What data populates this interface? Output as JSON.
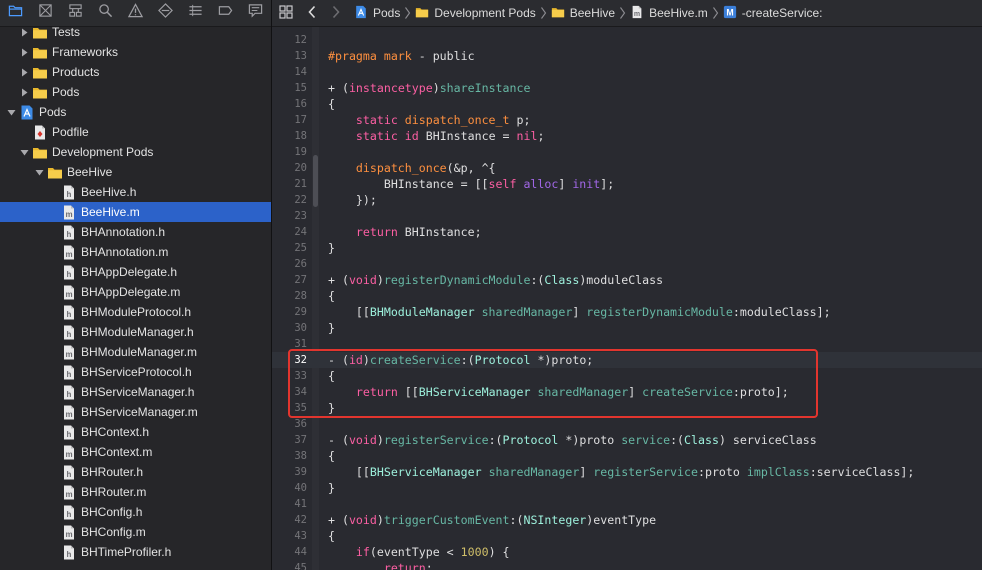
{
  "navigator": {
    "toolbar_icons": [
      "folder-icon",
      "source-control-icon",
      "hierarchy-icon",
      "search-icon",
      "warning-icon",
      "test-icon",
      "debug-icon",
      "breakpoint-icon",
      "report-icon"
    ],
    "tree": [
      {
        "label": "Tests",
        "kind": "folder",
        "depth": 1,
        "expanded": false
      },
      {
        "label": "Frameworks",
        "kind": "folder",
        "depth": 1,
        "expanded": false
      },
      {
        "label": "Products",
        "kind": "folder",
        "depth": 1,
        "expanded": false
      },
      {
        "label": "Pods",
        "kind": "folder",
        "depth": 1,
        "expanded": false
      },
      {
        "label": "Pods",
        "kind": "project",
        "depth": 0,
        "expanded": true
      },
      {
        "label": "Podfile",
        "kind": "ruby",
        "depth": 1,
        "expanded": null
      },
      {
        "label": "Development Pods",
        "kind": "folder",
        "depth": 1,
        "expanded": true
      },
      {
        "label": "BeeHive",
        "kind": "folder",
        "depth": 2,
        "expanded": true
      },
      {
        "label": "BeeHive.h",
        "kind": "h",
        "depth": 3,
        "expanded": null
      },
      {
        "label": "BeeHive.m",
        "kind": "m",
        "depth": 3,
        "expanded": null,
        "selected": true
      },
      {
        "label": "BHAnnotation.h",
        "kind": "h",
        "depth": 3,
        "expanded": null
      },
      {
        "label": "BHAnnotation.m",
        "kind": "m",
        "depth": 3,
        "expanded": null
      },
      {
        "label": "BHAppDelegate.h",
        "kind": "h",
        "depth": 3,
        "expanded": null
      },
      {
        "label": "BHAppDelegate.m",
        "kind": "m",
        "depth": 3,
        "expanded": null
      },
      {
        "label": "BHModuleProtocol.h",
        "kind": "h",
        "depth": 3,
        "expanded": null
      },
      {
        "label": "BHModuleManager.h",
        "kind": "h",
        "depth": 3,
        "expanded": null
      },
      {
        "label": "BHModuleManager.m",
        "kind": "m",
        "depth": 3,
        "expanded": null
      },
      {
        "label": "BHServiceProtocol.h",
        "kind": "h",
        "depth": 3,
        "expanded": null
      },
      {
        "label": "BHServiceManager.h",
        "kind": "h",
        "depth": 3,
        "expanded": null
      },
      {
        "label": "BHServiceManager.m",
        "kind": "m",
        "depth": 3,
        "expanded": null
      },
      {
        "label": "BHContext.h",
        "kind": "h",
        "depth": 3,
        "expanded": null
      },
      {
        "label": "BHContext.m",
        "kind": "m",
        "depth": 3,
        "expanded": null
      },
      {
        "label": "BHRouter.h",
        "kind": "h",
        "depth": 3,
        "expanded": null
      },
      {
        "label": "BHRouter.m",
        "kind": "m",
        "depth": 3,
        "expanded": null
      },
      {
        "label": "BHConfig.h",
        "kind": "h",
        "depth": 3,
        "expanded": null
      },
      {
        "label": "BHConfig.m",
        "kind": "m",
        "depth": 3,
        "expanded": null
      },
      {
        "label": "BHTimeProfiler.h",
        "kind": "h",
        "depth": 3,
        "expanded": null
      }
    ]
  },
  "jumpbar": {
    "crumbs": [
      {
        "label": "Pods",
        "icon": "project-icon"
      },
      {
        "label": "Development Pods",
        "icon": "folder-icon"
      },
      {
        "label": "BeeHive",
        "icon": "folder-icon"
      },
      {
        "label": "BeeHive.m",
        "icon": "m-file-icon"
      },
      {
        "label": "-createService:",
        "icon": "method-icon"
      }
    ]
  },
  "editor": {
    "current_line": 32,
    "lines": [
      {
        "n": "12",
        "tokens": [
          [
            "pln",
            ""
          ]
        ]
      },
      {
        "n": "13",
        "tokens": [
          [
            "pre",
            "#pragma mark"
          ],
          [
            "pln",
            " - public"
          ]
        ]
      },
      {
        "n": "14",
        "tokens": [
          [
            "pln",
            ""
          ]
        ]
      },
      {
        "n": "15",
        "tokens": [
          [
            "pln",
            "+ ("
          ],
          [
            "kw",
            "instancetype"
          ],
          [
            "pln",
            ")"
          ],
          [
            "meth",
            "shareInstance"
          ]
        ]
      },
      {
        "n": "16",
        "tokens": [
          [
            "pln",
            "{"
          ]
        ]
      },
      {
        "n": "17",
        "tokens": [
          [
            "pln",
            "    "
          ],
          [
            "kw",
            "static"
          ],
          [
            "pln",
            " "
          ],
          [
            "org",
            "dispatch_once_t"
          ],
          [
            "pln",
            " p;"
          ]
        ]
      },
      {
        "n": "18",
        "tokens": [
          [
            "pln",
            "    "
          ],
          [
            "kw",
            "static"
          ],
          [
            "pln",
            " "
          ],
          [
            "kw",
            "id"
          ],
          [
            "pln",
            " BHInstance = "
          ],
          [
            "kw",
            "nil"
          ],
          [
            "pln",
            ";"
          ]
        ]
      },
      {
        "n": "19",
        "tokens": [
          [
            "pln",
            ""
          ]
        ]
      },
      {
        "n": "20",
        "tokens": [
          [
            "pln",
            "    "
          ],
          [
            "org",
            "dispatch_once"
          ],
          [
            "pln",
            "(&p, ^{"
          ]
        ]
      },
      {
        "n": "21",
        "tokens": [
          [
            "pln",
            "        BHInstance = [["
          ],
          [
            "kw",
            "self"
          ],
          [
            "pln",
            " "
          ],
          [
            "sys",
            "alloc"
          ],
          [
            "pln",
            "] "
          ],
          [
            "sys",
            "init"
          ],
          [
            "pln",
            "];"
          ]
        ]
      },
      {
        "n": "22",
        "tokens": [
          [
            "pln",
            "    });"
          ]
        ]
      },
      {
        "n": "23",
        "tokens": [
          [
            "pln",
            ""
          ]
        ]
      },
      {
        "n": "24",
        "tokens": [
          [
            "pln",
            "    "
          ],
          [
            "kw",
            "return"
          ],
          [
            "pln",
            " BHInstance;"
          ]
        ]
      },
      {
        "n": "25",
        "tokens": [
          [
            "pln",
            "}"
          ]
        ]
      },
      {
        "n": "26",
        "tokens": [
          [
            "pln",
            ""
          ]
        ]
      },
      {
        "n": "27",
        "tokens": [
          [
            "pln",
            "+ ("
          ],
          [
            "kw",
            "void"
          ],
          [
            "pln",
            ")"
          ],
          [
            "meth",
            "registerDynamicModule"
          ],
          [
            "pln",
            ":("
          ],
          [
            "usr",
            "Class"
          ],
          [
            "pln",
            ")moduleClass"
          ]
        ]
      },
      {
        "n": "28",
        "tokens": [
          [
            "pln",
            "{"
          ]
        ]
      },
      {
        "n": "29",
        "tokens": [
          [
            "pln",
            "    [["
          ],
          [
            "usr",
            "BHModuleManager"
          ],
          [
            "pln",
            " "
          ],
          [
            "meth",
            "sharedManager"
          ],
          [
            "pln",
            "] "
          ],
          [
            "meth",
            "registerDynamicModule"
          ],
          [
            "pln",
            ":moduleClass];"
          ]
        ]
      },
      {
        "n": "30",
        "tokens": [
          [
            "pln",
            "}"
          ]
        ]
      },
      {
        "n": "31",
        "tokens": [
          [
            "pln",
            ""
          ]
        ]
      },
      {
        "n": "32",
        "tokens": [
          [
            "pln",
            "- ("
          ],
          [
            "kw",
            "id"
          ],
          [
            "pln",
            ")"
          ],
          [
            "meth",
            "createService"
          ],
          [
            "pln",
            ":("
          ],
          [
            "usr",
            "Protocol"
          ],
          [
            "pln",
            " *)proto;"
          ]
        ]
      },
      {
        "n": "33",
        "tokens": [
          [
            "pln",
            "{"
          ]
        ]
      },
      {
        "n": "34",
        "tokens": [
          [
            "pln",
            "    "
          ],
          [
            "kw",
            "return"
          ],
          [
            "pln",
            " [["
          ],
          [
            "usr",
            "BHServiceManager"
          ],
          [
            "pln",
            " "
          ],
          [
            "meth",
            "sharedManager"
          ],
          [
            "pln",
            "] "
          ],
          [
            "meth",
            "createService"
          ],
          [
            "pln",
            ":proto];"
          ]
        ]
      },
      {
        "n": "35",
        "tokens": [
          [
            "pln",
            "}"
          ]
        ]
      },
      {
        "n": "36",
        "tokens": [
          [
            "pln",
            ""
          ]
        ]
      },
      {
        "n": "37",
        "tokens": [
          [
            "pln",
            "- ("
          ],
          [
            "kw",
            "void"
          ],
          [
            "pln",
            ")"
          ],
          [
            "meth",
            "registerService"
          ],
          [
            "pln",
            ":("
          ],
          [
            "usr",
            "Protocol"
          ],
          [
            "pln",
            " *)proto "
          ],
          [
            "meth",
            "service"
          ],
          [
            "pln",
            ":("
          ],
          [
            "usr",
            "Class"
          ],
          [
            "pln",
            ") serviceClass"
          ]
        ]
      },
      {
        "n": "38",
        "tokens": [
          [
            "pln",
            "{"
          ]
        ]
      },
      {
        "n": "39",
        "tokens": [
          [
            "pln",
            "    [["
          ],
          [
            "usr",
            "BHServiceManager"
          ],
          [
            "pln",
            " "
          ],
          [
            "meth",
            "sharedManager"
          ],
          [
            "pln",
            "] "
          ],
          [
            "meth",
            "registerService"
          ],
          [
            "pln",
            ":proto "
          ],
          [
            "meth",
            "implClass"
          ],
          [
            "pln",
            ":serviceClass];"
          ]
        ]
      },
      {
        "n": "40",
        "tokens": [
          [
            "pln",
            "}"
          ]
        ]
      },
      {
        "n": "41",
        "tokens": [
          [
            "pln",
            ""
          ]
        ]
      },
      {
        "n": "42",
        "tokens": [
          [
            "pln",
            "+ ("
          ],
          [
            "kw",
            "void"
          ],
          [
            "pln",
            ")"
          ],
          [
            "meth",
            "triggerCustomEvent"
          ],
          [
            "pln",
            ":("
          ],
          [
            "usr",
            "NSInteger"
          ],
          [
            "pln",
            ")eventType"
          ]
        ]
      },
      {
        "n": "43",
        "tokens": [
          [
            "pln",
            "{"
          ]
        ]
      },
      {
        "n": "44",
        "tokens": [
          [
            "pln",
            "    "
          ],
          [
            "kw",
            "if"
          ],
          [
            "pln",
            "(eventType < "
          ],
          [
            "num",
            "1000"
          ],
          [
            "pln",
            ") {"
          ]
        ]
      },
      {
        "n": "45",
        "tokens": [
          [
            "pln",
            "        "
          ],
          [
            "kw",
            "return"
          ],
          [
            "pln",
            ";"
          ]
        ]
      }
    ]
  },
  "colors": {
    "selection": "#2c62c9",
    "highlight_box": "#e2352e",
    "folder": "#f5c63c",
    "keyword": "#fc5fa3"
  }
}
